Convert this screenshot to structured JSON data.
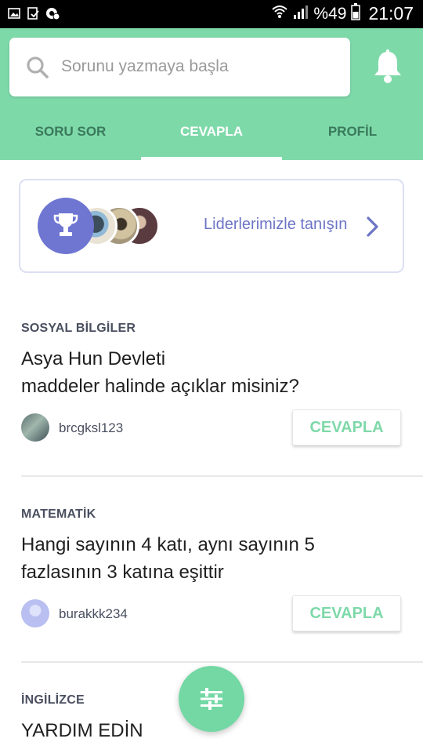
{
  "status_bar": {
    "battery_percent": "%49",
    "time": "21:07",
    "icons": [
      "image-icon",
      "download-icon",
      "settings-notification-icon",
      "wifi-icon",
      "signal-icon",
      "battery-icon"
    ]
  },
  "search": {
    "placeholder": "Sorunu yazmaya başla",
    "value": ""
  },
  "tabs": [
    {
      "label": "SORU SOR",
      "active": false
    },
    {
      "label": "CEVAPLA",
      "active": true
    },
    {
      "label": "PROFİL",
      "active": false
    }
  ],
  "leaders": {
    "link_label": "Liderlerimizle tanışın"
  },
  "questions": [
    {
      "subject": "SOSYAL BİLGİLER",
      "lines": [
        "Asya Hun Devleti",
        "maddeler halinde açıklar misiniz?"
      ],
      "user": "brcgksl123",
      "answer_label": "CEVAPLA"
    },
    {
      "subject": "MATEMATİK",
      "lines": [
        "Hangi sayının 4 katı, aynı sayının 5",
        "fazlasının 3 katına eşittir"
      ],
      "user": "burakkk234",
      "answer_label": "CEVAPLA"
    },
    {
      "subject": "İNGİLİZCE",
      "lines": [
        "YARDIM EDİN"
      ],
      "user": "",
      "answer_label": ""
    }
  ],
  "colors": {
    "accent": "#7ed9a9",
    "leader_accent": "#6e76d2",
    "leader_link": "#6c74c6"
  }
}
